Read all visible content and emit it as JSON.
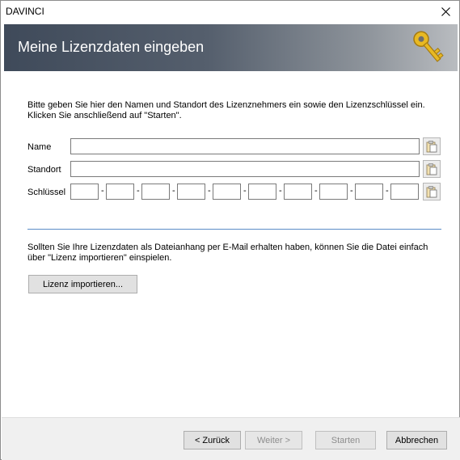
{
  "window": {
    "title": "DAVINCI"
  },
  "banner": {
    "heading": "Meine Lizenzdaten eingeben"
  },
  "intro": {
    "line1": "Bitte geben Sie hier den Namen und Standort des Lizenznehmers ein sowie den Lizenzschlüssel ein.",
    "line2": "Klicken Sie anschließend auf \"Starten\"."
  },
  "form": {
    "name_label": "Name",
    "name_value": "",
    "location_label": "Standort",
    "location_value": "",
    "key_label": "Schlüssel",
    "key_segments": [
      "",
      "",
      "",
      "",
      "",
      "",
      "",
      "",
      "",
      ""
    ],
    "separator": "-"
  },
  "import": {
    "line1": "Sollten Sie Ihre Lizenzdaten als Dateianhang per E-Mail erhalten haben, können Sie die Datei einfach",
    "line2": "über \"Lizenz importieren\" einspielen.",
    "button_label": "Lizenz importieren..."
  },
  "footer": {
    "back_label": "< Zurück",
    "next_label": "Weiter >",
    "start_label": "Starten",
    "cancel_label": "Abbrechen"
  },
  "icons": {
    "close": "close-icon",
    "key": "key-icon",
    "paste": "paste-icon"
  },
  "colors": {
    "divider": "#5b8cc7",
    "banner_dark": "#3f4a5a",
    "banner_light": "#b9bcc0",
    "key_gold": "#e0b020"
  }
}
